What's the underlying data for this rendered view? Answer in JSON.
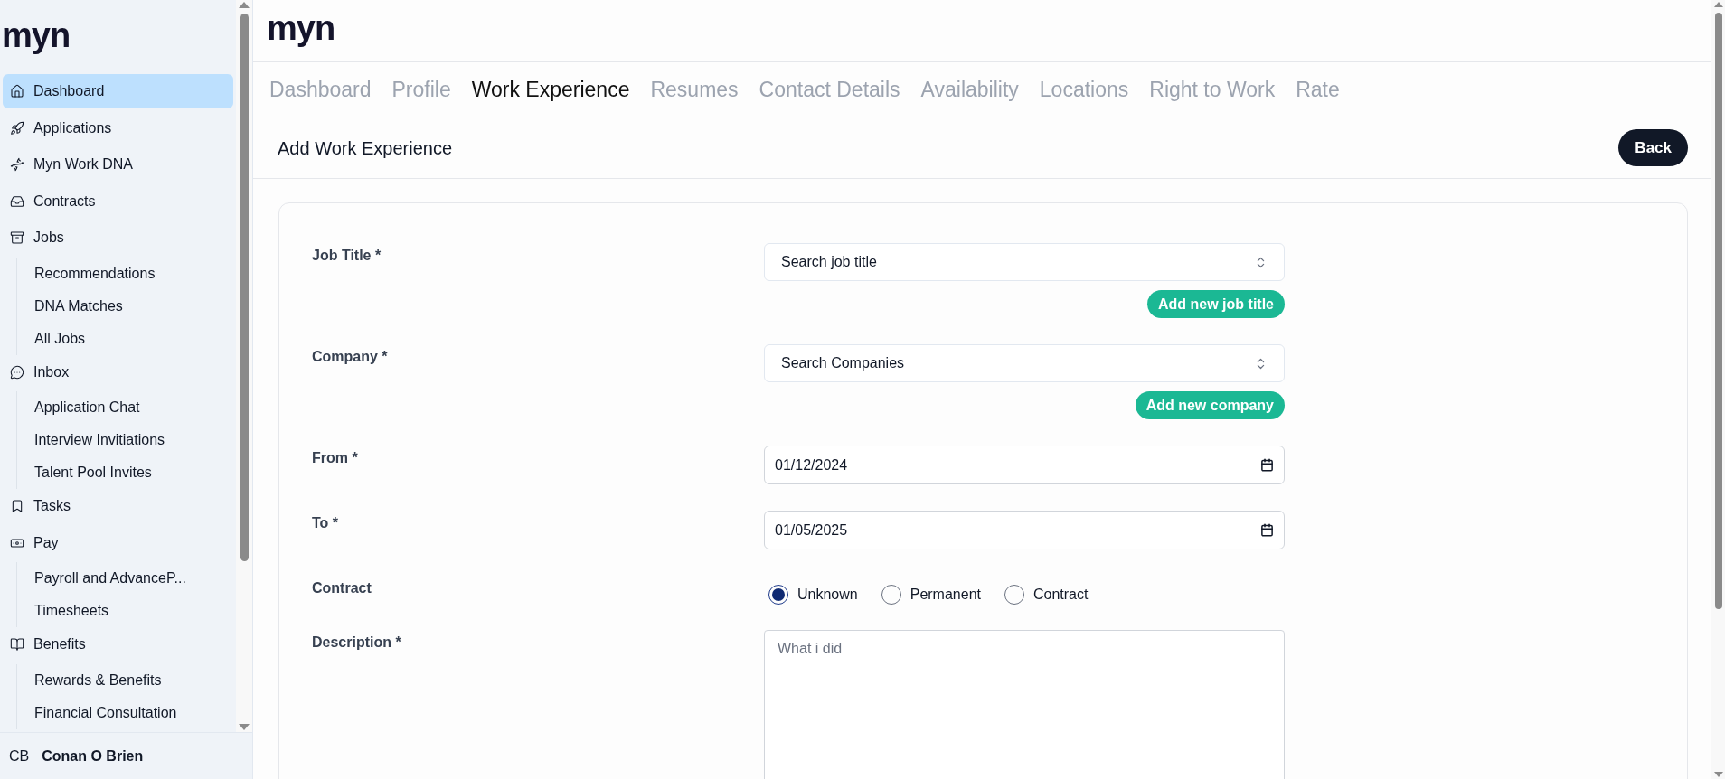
{
  "sidebar": {
    "logo": "myn",
    "items": [
      {
        "label": "Dashboard",
        "selected": true
      },
      {
        "label": "Applications",
        "selected": false
      },
      {
        "label": "Myn Work DNA",
        "selected": false
      },
      {
        "label": "Contracts",
        "selected": false
      },
      {
        "label": "Jobs",
        "selected": false,
        "children": [
          {
            "label": "Recommendations",
            "selected": false
          },
          {
            "label": "DNA Matches",
            "selected": false
          },
          {
            "label": "All Jobs",
            "selected": false
          }
        ]
      },
      {
        "label": "Inbox",
        "selected": false,
        "children": [
          {
            "label": "Application Chat",
            "selected": false
          },
          {
            "label": "Interview Invitiations",
            "selected": false
          },
          {
            "label": "Talent Pool Invites",
            "selected": false
          }
        ]
      },
      {
        "label": "Tasks",
        "selected": false
      },
      {
        "label": "Pay",
        "selected": false,
        "children": [
          {
            "label": "Payroll and AdvanceP...",
            "selected": false
          },
          {
            "label": "Timesheets",
            "selected": false
          }
        ]
      },
      {
        "label": "Benefits",
        "selected": false,
        "children": [
          {
            "label": "Rewards & Benefits",
            "selected": false
          },
          {
            "label": "Financial Consultation",
            "selected": false
          }
        ]
      }
    ],
    "user": {
      "initials": "CB",
      "name": "Conan O Brien"
    }
  },
  "header": {
    "logo": "myn"
  },
  "tabs": [
    {
      "label": "Dashboard",
      "selected": false
    },
    {
      "label": "Profile",
      "selected": false
    },
    {
      "label": "Work Experience",
      "selected": true
    },
    {
      "label": "Resumes",
      "selected": false
    },
    {
      "label": "Contact Details",
      "selected": false
    },
    {
      "label": "Availability",
      "selected": false
    },
    {
      "label": "Locations",
      "selected": false
    },
    {
      "label": "Right to Work",
      "selected": false
    },
    {
      "label": "Rate",
      "selected": false
    }
  ],
  "page": {
    "title": "Add Work Experience",
    "back_button": "Back"
  },
  "form": [
    {
      "kind": "select",
      "label": "Job Title *",
      "placeholder": "Search job title",
      "action": "Add new job title"
    },
    {
      "kind": "select",
      "label": "Company *",
      "placeholder": "Search Companies",
      "action": "Add new company"
    },
    {
      "kind": "date",
      "label": "From *",
      "value": "01/12/2024"
    },
    {
      "kind": "date",
      "label": "To *",
      "value": "01/05/2025"
    },
    {
      "kind": "radio",
      "label": "Contract",
      "options": [
        {
          "label": "Unknown",
          "selected": true
        },
        {
          "label": "Permanent",
          "selected": false
        },
        {
          "label": "Contract",
          "selected": false
        }
      ]
    },
    {
      "kind": "textarea",
      "label": "Description *",
      "placeholder": "What i did"
    }
  ]
}
